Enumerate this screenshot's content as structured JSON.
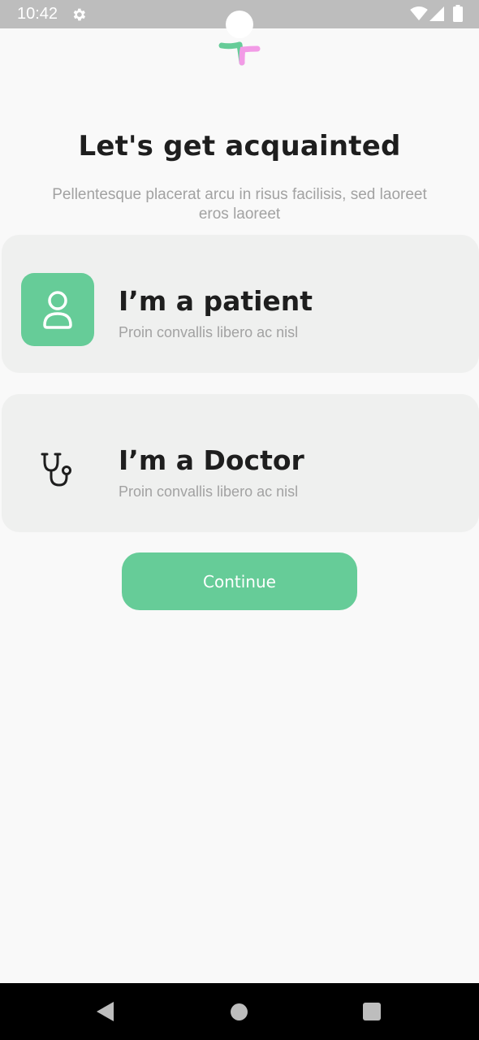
{
  "status_bar": {
    "time": "10:42",
    "icons": [
      "gear-icon",
      "wifi-icon",
      "signal-icon",
      "battery-icon"
    ]
  },
  "logo": {
    "icon": "app-logo",
    "colors": [
      "#66cc98",
      "#f29be6",
      "#ffffff"
    ]
  },
  "header": {
    "title": "Let's get acquainted",
    "subtitle": "Pellentesque placerat arcu in risus facilisis, sed laoreet eros laoreet"
  },
  "roles": [
    {
      "title": "I’m a patient",
      "subtitle": "Proin convallis libero ac nisl",
      "icon": "person-icon",
      "selected": true
    },
    {
      "title": "I’m a Doctor",
      "subtitle": "Proin convallis libero ac nisl",
      "icon": "stethoscope-icon",
      "selected": false
    }
  ],
  "continue_label": "Continue",
  "colors": {
    "accent": "#66cc98",
    "card_background": "#eff0ef",
    "text_primary": "#1e1e1e",
    "text_secondary": "#a2a2a2",
    "status_bar": "#bdbdbd"
  },
  "nav_bar": {
    "buttons": [
      "back-icon",
      "home-icon",
      "recents-icon"
    ]
  }
}
